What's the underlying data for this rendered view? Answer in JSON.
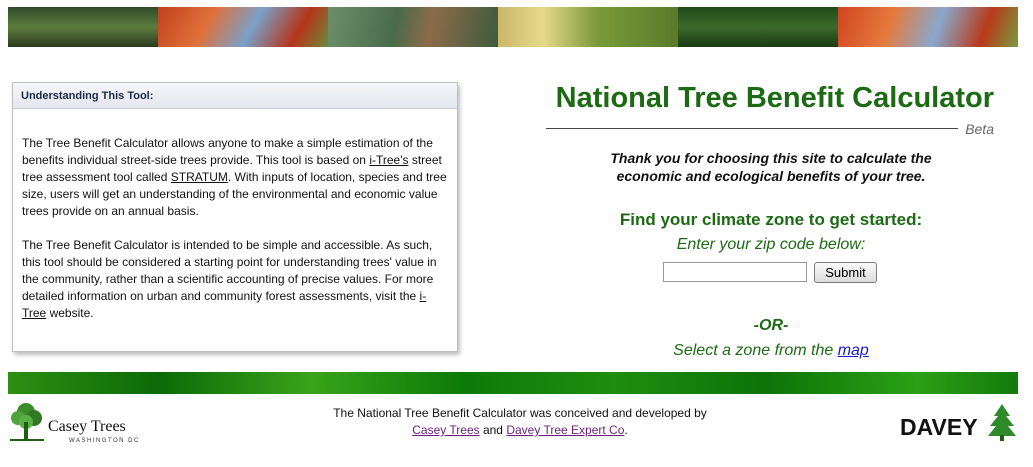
{
  "banner": {
    "image_name": "tree-photo-banner"
  },
  "panel": {
    "heading": "Understanding This Tool:",
    "para1": {
      "t1": "The Tree Benefit Calculator allows anyone to make a simple estimation of the benefits individual street-side trees provide. This tool is based on ",
      "link1": "i-Tree's",
      "t2": " street tree assessment tool called ",
      "link2": "STRATUM",
      "t3": ". With inputs of location, species and tree size, users will get an understanding of the environmental and economic value trees provide on an annual basis."
    },
    "para2": {
      "t1": "The Tree Benefit Calculator is intended to be simple and accessible. As such, this tool should be considered a starting point for understanding trees' value in the community, rather than a scientific accounting of precise values. For more detailed information on urban and community forest assessments, visit the ",
      "link": "i-Tree",
      "t2": " website."
    }
  },
  "main": {
    "title": "National Tree Benefit Calculator",
    "beta": "Beta",
    "thanks_line1": "Thank you for choosing this site to calculate the",
    "thanks_line2": "economic and ecological benefits of your tree.",
    "find": "Find your climate zone to get started:",
    "enter": "Enter your zip code below:",
    "zip_value": "",
    "submit": "Submit",
    "or": "-OR-",
    "select_text": "Select a zone from the ",
    "map_link": "map"
  },
  "footer": {
    "line1": "The National Tree Benefit Calculator was conceived and developed by",
    "link1": "Casey Trees",
    "and": " and ",
    "link2": "Davey Tree Expert Co",
    "period": "."
  },
  "logos": {
    "casey_name": "Casey Trees",
    "casey_sub": "WASHINGTON DC",
    "davey_name": "DAVEY"
  },
  "colors": {
    "accent_green": "#1c6b14",
    "link_blue": "#1a1ad6",
    "link_purple": "#6b1f7a"
  }
}
